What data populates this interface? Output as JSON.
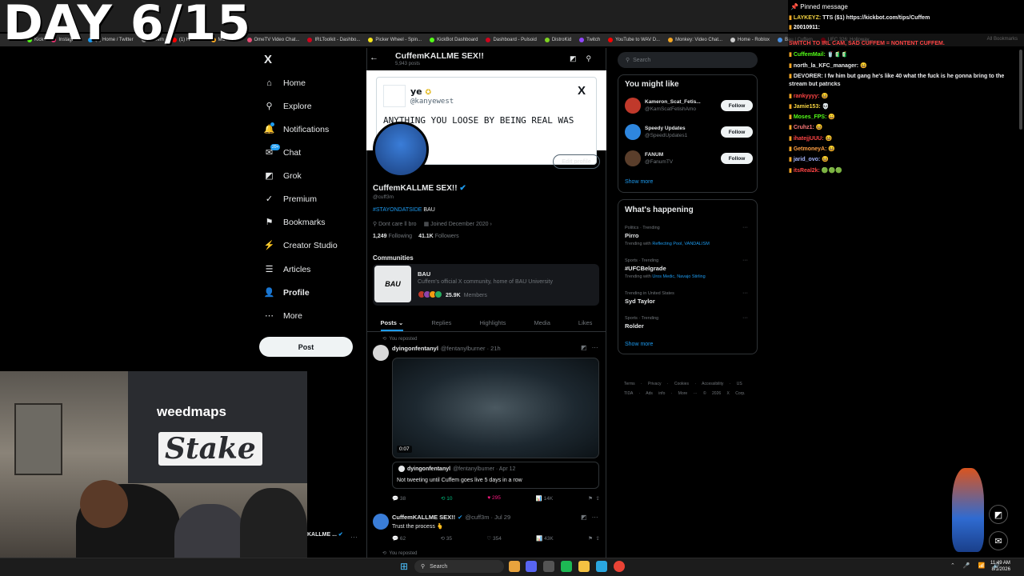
{
  "overlay": {
    "day_label": "DAY 6/15"
  },
  "bookmarks": {
    "items": [
      {
        "label": "Kick",
        "color": "#53fc18"
      },
      {
        "label": "Instagram",
        "color": "#e1306c"
      },
      {
        "label": "(4) Home / Twitter",
        "color": "#1d9bf0"
      },
      {
        "label": "Cuffem",
        "color": "#888888"
      },
      {
        "label": "(1) Harvest",
        "color": "#ff0000"
      },
      {
        "label": "MONKEY",
        "color": "#f5a623"
      },
      {
        "label": "OmeTV Video Chat...",
        "color": "#e94e77"
      },
      {
        "label": "IRLToolkit - Dashbo...",
        "color": "#d0021b"
      },
      {
        "label": "Picker Wheel - Spin...",
        "color": "#f8e71c"
      },
      {
        "label": "KickBot Dashboard",
        "color": "#53fc18"
      },
      {
        "label": "Dashboard - Pulsoid",
        "color": "#d0021b"
      },
      {
        "label": "DistroKid",
        "color": "#7ed321"
      },
      {
        "label": "Twitch",
        "color": "#9146ff"
      },
      {
        "label": "YouTube to WAV D...",
        "color": "#ff0000"
      },
      {
        "label": "Monkey: Video Chat...",
        "color": "#f5a623"
      },
      {
        "label": "Home - Roblox",
        "color": "#cccccc"
      },
      {
        "label": "Bau | Cuffem",
        "color": "#4a90e2"
      },
      {
        "label": "UFC 326: Holloway...",
        "color": "#d0021b"
      }
    ],
    "all_bookmarks": "All Bookmarks"
  },
  "nav": {
    "logo": "X",
    "items": [
      {
        "label": "Home",
        "icon": "home-icon",
        "glyph": "⌂"
      },
      {
        "label": "Explore",
        "icon": "search-icon",
        "glyph": "⚲"
      },
      {
        "label": "Notifications",
        "icon": "bell-icon",
        "glyph": "🔔"
      },
      {
        "label": "Chat",
        "icon": "chat-icon",
        "glyph": "✉"
      },
      {
        "label": "Grok",
        "icon": "grok-icon",
        "glyph": "◩"
      },
      {
        "label": "Premium",
        "icon": "premium-icon",
        "glyph": "✓"
      },
      {
        "label": "Bookmarks",
        "icon": "bookmark-icon",
        "glyph": "⚑"
      },
      {
        "label": "Creator Studio",
        "icon": "creator-studio-icon",
        "glyph": "⚡"
      },
      {
        "label": "Articles",
        "icon": "articles-icon",
        "glyph": "☰"
      },
      {
        "label": "Profile",
        "icon": "profile-icon",
        "glyph": "👤"
      },
      {
        "label": "More",
        "icon": "more-icon",
        "glyph": "⋯"
      }
    ],
    "chat_badge": "20+",
    "post_label": "Post"
  },
  "header": {
    "title": "CuffemKALLME SEX!!",
    "subtitle": "5,943 posts",
    "back": "←"
  },
  "banner_tweet": {
    "name": "ye",
    "handle": "@kanyewest",
    "text": "ANYTHING YOU LOOSE BY BEING REAL WAS",
    "x": "X"
  },
  "profile": {
    "edit_label": "Edit profile",
    "name": "CuffemKALLME SEX!!",
    "handle": "@cuff3m",
    "bio_tag": "#STAYONDATSIDE",
    "bio_rest": " BAU",
    "location": "Dont care ll bro",
    "joined": "Joined December 2020",
    "following_count": "1,249",
    "following_label": "Following",
    "followers_count": "41.1K",
    "followers_label": "Followers"
  },
  "communities": {
    "title": "Communities",
    "name": "BAU",
    "desc": "Cuffem's official X community, home of BAU University",
    "members_count": "25.9K",
    "members_label": "Members",
    "logo_text": "BAU"
  },
  "tabs": [
    "Posts",
    "Replies",
    "Highlights",
    "Media",
    "Likes"
  ],
  "post1": {
    "reposted": "You reposted",
    "name": "dyingonfentanyl",
    "handle": "@fentanylburner · 21h",
    "video_time": "0:07",
    "quote_name": "dyingonfentanyl",
    "quote_handle": "@fentanylburner · Apr 12",
    "quote_text": "Not tweeting until Cuffem goes live 5 days in a row",
    "replies": "38",
    "reposts": "10",
    "likes": "295",
    "views": "14K"
  },
  "post2": {
    "name": "CuffemKALLME SEX!!",
    "handle": "@cuff3m · Jul 29",
    "text": "Trust the process 🫰",
    "replies": "62",
    "reposts": "35",
    "likes": "354",
    "views": "43K"
  },
  "post3": {
    "reposted": "You reposted"
  },
  "right": {
    "search_placeholder": "Search",
    "suggest_title": "You might like",
    "suggestions": [
      {
        "name": "Kameron_Scat_Fetis...",
        "handle": "@KamScatFetishAmo",
        "follow": "Follow",
        "color": "#c0392b"
      },
      {
        "name": "Speedy Updates",
        "handle": "@SpeedUpdates1",
        "follow": "Follow",
        "color": "#2e86de"
      },
      {
        "name": "FANUM",
        "handle": "@FanumTV",
        "follow": "Follow",
        "color": "#5a3e2b"
      }
    ],
    "show_more": "Show more",
    "happening_title": "What's happening",
    "trends": [
      {
        "cat": "Politics · Trending",
        "title": "Pirro",
        "with": "Trending with",
        "tags": "Reflecting Pool, VANDALISM"
      },
      {
        "cat": "Sports · Trending",
        "title": "#UFCBelgrade",
        "with": "Trending with",
        "tags": "Uros Medic, Navajo Stirling"
      },
      {
        "cat": "Trending in United States",
        "title": "Syd Taylor",
        "with": "",
        "tags": ""
      },
      {
        "cat": "Sports · Trending",
        "title": "Rolder",
        "with": "",
        "tags": ""
      }
    ],
    "show_more2": "Show more",
    "footer": "Terms · Privacy · Cookies · Accessibility · US TIDA · Ads info · More ··· © 2026 X Corp."
  },
  "chat": {
    "pinned": "Pinned message",
    "lines": [
      {
        "user": "LAYKEYZ:",
        "ucolor": "#f5d442",
        "msg": "TTS ($1) https://kickbot.com/tips/Cuffem"
      },
      {
        "user": "20010911:",
        "ucolor": "#ffffff",
        "msg": ""
      },
      {
        "user": "",
        "ucolor": "#ff4545",
        "msg": "SWITCH TO IRL CAM, SAD CUFFEM = NONTENT CUFFEM."
      },
      {
        "user": "CuffemMail:",
        "ucolor": "#53fc18",
        "msg": "🥤🧃🧃"
      },
      {
        "user": "north_la_KFC_manager:",
        "ucolor": "#e7e9ea",
        "msg": "😆"
      },
      {
        "user": "DEVORER:",
        "ucolor": "#e7e9ea",
        "msg": "I fw him but gang he's like 40 what the fuck is he gonna bring to the"
      },
      {
        "user": "",
        "ucolor": "#e7e9ea",
        "msg": "stream but patricks"
      },
      {
        "user": "rankyyyy:",
        "ucolor": "#ff4545",
        "msg": "😆"
      },
      {
        "user": "Jamie153:",
        "ucolor": "#f5d442",
        "msg": "💀"
      },
      {
        "user": "Moses_FPS:",
        "ucolor": "#53fc18",
        "msg": "😄"
      },
      {
        "user": "Cruhz1:",
        "ucolor": "#ff7b7b",
        "msg": "😆"
      },
      {
        "user": "ihatejjUUU:",
        "ucolor": "#ff4545",
        "msg": "😆"
      },
      {
        "user": "GetmoneyA:",
        "ucolor": "#ff9f43",
        "msg": "😆"
      },
      {
        "user": "jarid_ovo:",
        "ucolor": "#a5b4fc",
        "msg": "😆"
      },
      {
        "user": "itsReal2k:",
        "ucolor": "#ff4545",
        "msg": "🟢🟢🟢"
      }
    ]
  },
  "webcam": {
    "brand1": "weedmaps",
    "brand2": "Stake"
  },
  "mini_profile": {
    "name": "KALLME ...",
    "dots": "···"
  },
  "taskbar": {
    "search": "Search",
    "time": "11:49 AM",
    "date": "8/1/2026"
  }
}
